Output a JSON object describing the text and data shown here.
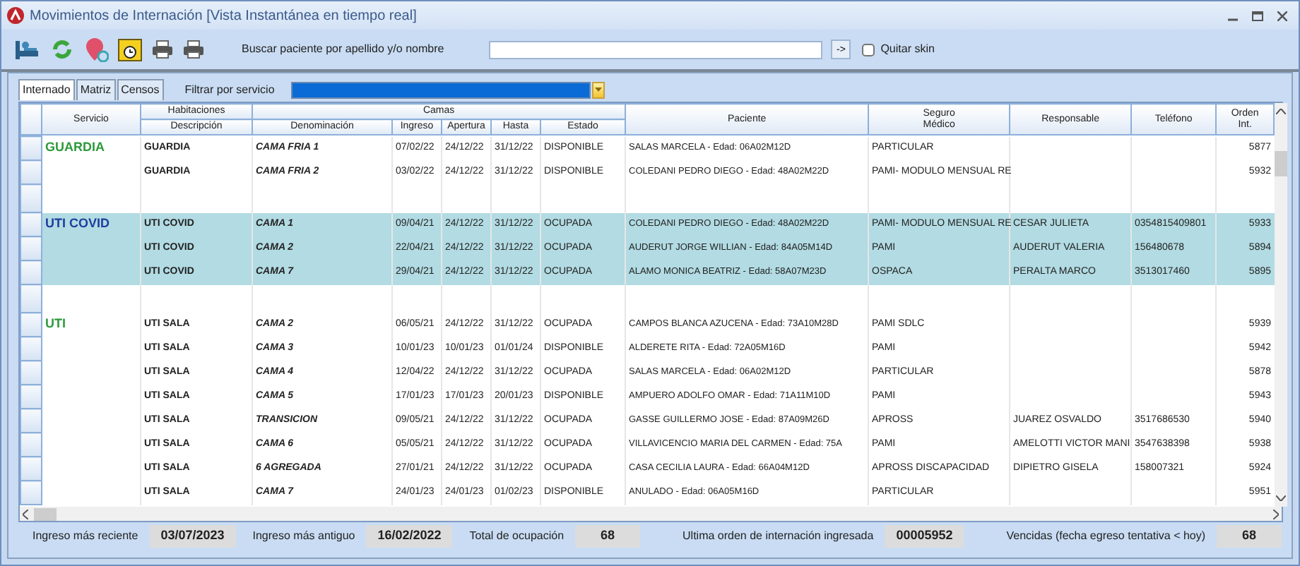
{
  "window": {
    "title": "Movimientos de Internación [Vista Instantánea en tiempo real]"
  },
  "toolbar": {
    "search_label": "Buscar paciente por apellido y/o nombre",
    "go_button": "->",
    "quitar_skin": {
      "label": "Quitar skin",
      "checked": false
    }
  },
  "tabs": [
    {
      "label": "Internado",
      "selected": true
    },
    {
      "label": "Matriz",
      "selected": false
    },
    {
      "label": "Censos",
      "selected": false
    }
  ],
  "filter": {
    "label": "Filtrar por servicio"
  },
  "grid": {
    "columns": [
      {
        "label": "Servicio"
      },
      {
        "group": "Habitaciones",
        "columns": [
          {
            "label": "Descripción"
          }
        ]
      },
      {
        "group": "Camas",
        "columns": [
          {
            "label": "Denominación"
          },
          {
            "label": "Ingreso"
          },
          {
            "label": "Apertura"
          },
          {
            "label": "Hasta"
          },
          {
            "label": "Estado"
          }
        ]
      },
      {
        "label": "Paciente"
      },
      {
        "label": "Seguro\nMédico"
      },
      {
        "label": "Responsable"
      },
      {
        "label": "Teléfono"
      },
      {
        "label": "Orden\nInt."
      }
    ],
    "groups": [
      {
        "service": "GUARDIA",
        "color": "#2e9a3c",
        "rows": [
          {
            "selected": false,
            "cells": [
              "GUARDIA",
              "CAMA FRIA 1",
              "07/02/22",
              "24/12/22",
              "31/12/22",
              "DISPONIBLE",
              "SALAS MARCELA - Edad: 06A02M12D",
              "PARTICULAR",
              null,
              null,
              "5877"
            ]
          },
          {
            "selected": false,
            "cells": [
              "GUARDIA",
              "CAMA FRIA 2",
              "03/02/22",
              "24/12/22",
              "31/12/22",
              "DISPONIBLE",
              "COLEDANI PEDRO DIEGO - Edad: 48A02M22D",
              "PAMI- MODULO MENSUAL RE",
              null,
              null,
              "5932"
            ]
          }
        ]
      },
      {
        "service": "UTI COVID",
        "color": "#1f3d9c",
        "rows": [
          {
            "selected": true,
            "cells": [
              "UTI COVID",
              "CAMA 1",
              "09/04/21",
              "24/12/22",
              "31/12/22",
              "OCUPADA",
              "COLEDANI PEDRO DIEGO - Edad: 48A02M22D",
              "PAMI- MODULO MENSUAL RE",
              "CESAR JULIETA",
              "0354815409801",
              "5933"
            ]
          },
          {
            "selected": true,
            "cells": [
              "UTI COVID",
              "CAMA 2",
              "22/04/21",
              "24/12/22",
              "31/12/22",
              "OCUPADA",
              "AUDERUT JORGE WILLIAN - Edad: 84A05M14D",
              "PAMI",
              "AUDERUT VALERIA",
              "156480678",
              "5894"
            ]
          },
          {
            "selected": true,
            "cells": [
              "UTI COVID",
              "CAMA 7",
              "29/04/21",
              "24/12/22",
              "31/12/22",
              "OCUPADA",
              "ALAMO MONICA BEATRIZ - Edad: 58A07M23D",
              "OSPACA",
              "PERALTA MARCO",
              "3513017460",
              "5895"
            ]
          }
        ]
      },
      {
        "service": "UTI",
        "color": "#2e9a3c",
        "rows": [
          {
            "selected": false,
            "cells": [
              "UTI SALA",
              "CAMA 2",
              "06/05/21",
              "24/12/22",
              "31/12/22",
              "OCUPADA",
              "CAMPOS BLANCA AZUCENA - Edad: 73A10M28D",
              "PAMI SDLC",
              null,
              null,
              "5939"
            ]
          },
          {
            "selected": false,
            "cells": [
              "UTI SALA",
              "CAMA 3",
              "10/01/23",
              "10/01/23",
              "01/01/24",
              "DISPONIBLE",
              "ALDERETE RITA - Edad: 72A05M16D",
              "PAMI",
              null,
              null,
              "5942"
            ]
          },
          {
            "selected": false,
            "cells": [
              "UTI SALA",
              "CAMA 4",
              "12/04/22",
              "24/12/22",
              "31/12/22",
              "OCUPADA",
              "SALAS MARCELA - Edad: 06A02M12D",
              "PARTICULAR",
              null,
              null,
              "5878"
            ]
          },
          {
            "selected": false,
            "cells": [
              "UTI SALA",
              "CAMA 5",
              "17/01/23",
              "17/01/23",
              "20/01/23",
              "DISPONIBLE",
              "AMPUERO ADOLFO OMAR - Edad: 71A11M10D",
              "PAMI",
              null,
              null,
              "5943"
            ]
          },
          {
            "selected": false,
            "cells": [
              "UTI SALA",
              "TRANSICION",
              "09/05/21",
              "24/12/22",
              "31/12/22",
              "OCUPADA",
              "GASSE GUILLERMO JOSE - Edad: 87A09M26D",
              "APROSS",
              "JUAREZ OSVALDO",
              "3517686530",
              "5940"
            ]
          },
          {
            "selected": false,
            "cells": [
              "UTI SALA",
              "CAMA 6",
              "05/05/21",
              "24/12/22",
              "31/12/22",
              "OCUPADA",
              "VILLAVICENCIO MARIA DEL CARMEN - Edad: 75A",
              "PAMI",
              "AMELOTTI VICTOR MANI",
              "3547638398",
              "5938"
            ]
          },
          {
            "selected": false,
            "cells": [
              "UTI SALA",
              "6 AGREGADA",
              "27/01/21",
              "24/12/22",
              "31/12/22",
              "OCUPADA",
              "CASA CECILIA LAURA - Edad: 66A04M12D",
              "APROSS DISCAPACIDAD",
              "DIPIETRO GISELA",
              "158007321",
              "5924"
            ]
          },
          {
            "selected": false,
            "cells": [
              "UTI SALA",
              "CAMA 7",
              "24/01/23",
              "24/01/23",
              "01/02/23",
              "DISPONIBLE",
              "ANULADO - Edad: 06A05M16D",
              "PARTICULAR",
              null,
              null,
              "5951"
            ]
          }
        ]
      }
    ]
  },
  "status_bar": [
    {
      "label": "Ingreso más reciente",
      "value": "03/07/2023"
    },
    {
      "label": "Ingreso más antiguo",
      "value": "16/02/2022"
    },
    {
      "label": "Total de ocupación",
      "value": "68"
    },
    {
      "label": "Ultima orden de internación ingresada",
      "value": "00005952"
    },
    {
      "label": "Vencidas (fecha egreso tentativa < hoy)",
      "value": "68"
    }
  ]
}
